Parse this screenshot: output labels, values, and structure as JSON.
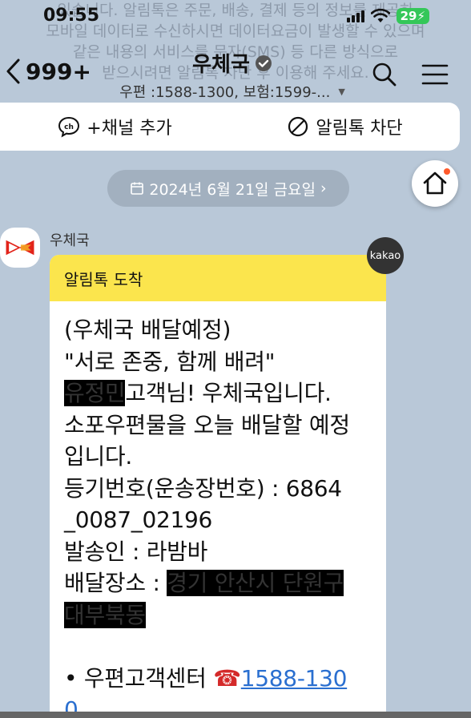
{
  "status_bar": {
    "time": "09:55",
    "battery": "29"
  },
  "notice": {
    "lines": [
      "있습니다. 알림톡은 주문, 배송, 결제 등의 정보를 제공하",
      "모바일 데이터로 수신하시면 데이터요금이 발생할 수 있으며",
      "같은 내용의 서비스를 문자(SMS) 등 다른 방식으로",
      "받으시려면 알림톡 차단 후 이용해 주세요."
    ]
  },
  "header": {
    "back_count": "999+",
    "title": "우체국",
    "subtitle": "우편 :1588-1300, 보험:1599-..."
  },
  "actions": {
    "add_channel": "+채널 추가",
    "block": "알림톡 차단"
  },
  "date_pill": "2024년 6월 21일 금요일",
  "message": {
    "sender": "우체국",
    "badge": "kakao",
    "header": "알림톡 도착",
    "lines": {
      "l1": "(우체국 배달예정)",
      "l2": "\"서로 존중, 함께 배려\"",
      "l3_redacted": "유정민",
      "l3_rest": "고객님! 우체국입니다.",
      "l4": "소포우편물을 오늘 배달할 예정",
      "l5": "입니다.",
      "l6": "등기번호(운송장번호) : 6864",
      "l7": "_0087_02196",
      "l8": "발송인 : 라밤바",
      "l9_prefix": "배달장소 : ",
      "l9_redacted": "경기 안산시 단원구",
      "l10_redacted": "대부북동",
      "l11_prefix": "• 우편고객센터 ",
      "l11_phone": "1588-130",
      "l12_phone": "0"
    }
  },
  "colors": {
    "background": "#b9c8d8",
    "card_header": "#fbe54d",
    "link": "#2a6fd0",
    "battery": "#34c759"
  }
}
